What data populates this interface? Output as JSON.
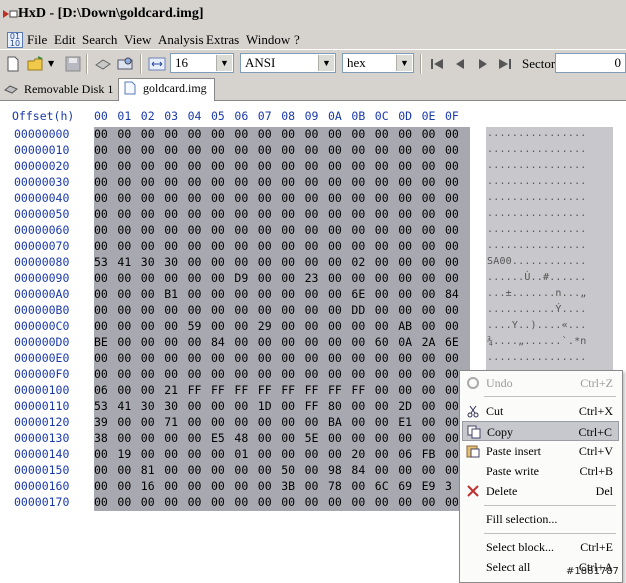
{
  "window": {
    "title": "HxD - [D:\\Down\\goldcard.img]"
  },
  "menu": [
    "File",
    "Edit",
    "Search",
    "View",
    "Analysis",
    "Extras",
    "Window",
    "?"
  ],
  "toolbar": {
    "bytes_per_row": "16",
    "charset": "ANSI",
    "offset_base": "hex",
    "sector_label": "Sector",
    "sector_value": "0"
  },
  "tabs": [
    {
      "label": "Removable Disk 1",
      "active": false
    },
    {
      "label": "goldcard.img",
      "active": true
    }
  ],
  "editor": {
    "offset_header": "Offset(h)",
    "column_headers": [
      "00",
      "01",
      "02",
      "03",
      "04",
      "05",
      "06",
      "07",
      "08",
      "09",
      "0A",
      "0B",
      "0C",
      "0D",
      "0E",
      "0F"
    ],
    "rows": [
      {
        "offset": "00000000",
        "bytes": [
          "00",
          "00",
          "00",
          "00",
          "00",
          "00",
          "00",
          "00",
          "00",
          "00",
          "00",
          "00",
          "00",
          "00",
          "00",
          "00"
        ],
        "text": "................"
      },
      {
        "offset": "00000010",
        "bytes": [
          "00",
          "00",
          "00",
          "00",
          "00",
          "00",
          "00",
          "00",
          "00",
          "00",
          "00",
          "00",
          "00",
          "00",
          "00",
          "00"
        ],
        "text": "................"
      },
      {
        "offset": "00000020",
        "bytes": [
          "00",
          "00",
          "00",
          "00",
          "00",
          "00",
          "00",
          "00",
          "00",
          "00",
          "00",
          "00",
          "00",
          "00",
          "00",
          "00"
        ],
        "text": "................"
      },
      {
        "offset": "00000030",
        "bytes": [
          "00",
          "00",
          "00",
          "00",
          "00",
          "00",
          "00",
          "00",
          "00",
          "00",
          "00",
          "00",
          "00",
          "00",
          "00",
          "00"
        ],
        "text": "................"
      },
      {
        "offset": "00000040",
        "bytes": [
          "00",
          "00",
          "00",
          "00",
          "00",
          "00",
          "00",
          "00",
          "00",
          "00",
          "00",
          "00",
          "00",
          "00",
          "00",
          "00"
        ],
        "text": "................"
      },
      {
        "offset": "00000050",
        "bytes": [
          "00",
          "00",
          "00",
          "00",
          "00",
          "00",
          "00",
          "00",
          "00",
          "00",
          "00",
          "00",
          "00",
          "00",
          "00",
          "00"
        ],
        "text": "................"
      },
      {
        "offset": "00000060",
        "bytes": [
          "00",
          "00",
          "00",
          "00",
          "00",
          "00",
          "00",
          "00",
          "00",
          "00",
          "00",
          "00",
          "00",
          "00",
          "00",
          "00"
        ],
        "text": "................"
      },
      {
        "offset": "00000070",
        "bytes": [
          "00",
          "00",
          "00",
          "00",
          "00",
          "00",
          "00",
          "00",
          "00",
          "00",
          "00",
          "00",
          "00",
          "00",
          "00",
          "00"
        ],
        "text": "................"
      },
      {
        "offset": "00000080",
        "bytes": [
          "53",
          "41",
          "30",
          "30",
          "00",
          "00",
          "00",
          "00",
          "00",
          "00",
          "00",
          "02",
          "00",
          "00",
          "00",
          "00"
        ],
        "text": "SA00............"
      },
      {
        "offset": "00000090",
        "bytes": [
          "00",
          "00",
          "00",
          "00",
          "00",
          "00",
          "D9",
          "00",
          "00",
          "23",
          "00",
          "00",
          "00",
          "00",
          "00",
          "00"
        ],
        "text": "......Ù..#......"
      },
      {
        "offset": "000000A0",
        "bytes": [
          "00",
          "00",
          "00",
          "B1",
          "00",
          "00",
          "00",
          "00",
          "00",
          "00",
          "00",
          "6E",
          "00",
          "00",
          "00",
          "84"
        ],
        "text": "...±.......n...„"
      },
      {
        "offset": "000000B0",
        "bytes": [
          "00",
          "00",
          "00",
          "00",
          "00",
          "00",
          "00",
          "00",
          "00",
          "00",
          "00",
          "DD",
          "00",
          "00",
          "00",
          "00"
        ],
        "text": "...........Ý...."
      },
      {
        "offset": "000000C0",
        "bytes": [
          "00",
          "00",
          "00",
          "00",
          "59",
          "00",
          "00",
          "29",
          "00",
          "00",
          "00",
          "00",
          "00",
          "AB",
          "00",
          "00"
        ],
        "text": "....Y..)....«..."
      },
      {
        "offset": "000000D0",
        "bytes": [
          "BE",
          "00",
          "00",
          "00",
          "00",
          "84",
          "00",
          "00",
          "00",
          "00",
          "00",
          "00",
          "60",
          "0A",
          "2A",
          "6E"
        ],
        "text": "¾....„......`.*n"
      },
      {
        "offset": "000000E0",
        "bytes": [
          "00",
          "00",
          "00",
          "00",
          "00",
          "00",
          "00",
          "00",
          "00",
          "00",
          "00",
          "00",
          "00",
          "00",
          "00",
          "00"
        ],
        "text": "................"
      },
      {
        "offset": "000000F0",
        "bytes": [
          "00",
          "00",
          "00",
          "00",
          "00",
          "00",
          "00",
          "00",
          "00",
          "00",
          "00",
          "00",
          "00",
          "00",
          "00",
          "00"
        ],
        "text": ""
      },
      {
        "offset": "00000100",
        "bytes": [
          "06",
          "00",
          "00",
          "21",
          "FF",
          "FF",
          "FF",
          "FF",
          "FF",
          "FF",
          "FF",
          "FF",
          "00",
          "00",
          "00",
          "00"
        ],
        "text": ""
      },
      {
        "offset": "00000110",
        "bytes": [
          "53",
          "41",
          "30",
          "30",
          "00",
          "00",
          "00",
          "1D",
          "00",
          "FF",
          "80",
          "00",
          "00",
          "2D",
          "00",
          "00"
        ],
        "text": ""
      },
      {
        "offset": "00000120",
        "bytes": [
          "39",
          "00",
          "00",
          "71",
          "00",
          "00",
          "00",
          "00",
          "00",
          "00",
          "BA",
          "00",
          "00",
          "E1",
          "00",
          "00"
        ],
        "text": ""
      },
      {
        "offset": "00000130",
        "bytes": [
          "38",
          "00",
          "00",
          "00",
          "00",
          "E5",
          "48",
          "00",
          "00",
          "5E",
          "00",
          "00",
          "00",
          "00",
          "00",
          "00"
        ],
        "text": ""
      },
      {
        "offset": "00000140",
        "bytes": [
          "00",
          "19",
          "00",
          "00",
          "00",
          "00",
          "01",
          "00",
          "00",
          "00",
          "00",
          "20",
          "00",
          "06",
          "FB",
          "00"
        ],
        "text": ""
      },
      {
        "offset": "00000150",
        "bytes": [
          "00",
          "00",
          "81",
          "00",
          "00",
          "00",
          "00",
          "00",
          "50",
          "00",
          "98",
          "84",
          "00",
          "00",
          "00",
          "00"
        ],
        "text": ""
      },
      {
        "offset": "00000160",
        "bytes": [
          "00",
          "00",
          "16",
          "00",
          "00",
          "00",
          "00",
          "00",
          "3B",
          "00",
          "78",
          "00",
          "6C",
          "69",
          "E9",
          "3"
        ],
        "text": ""
      },
      {
        "offset": "00000170",
        "bytes": [
          "00",
          "00",
          "00",
          "00",
          "00",
          "00",
          "00",
          "00",
          "00",
          "00",
          "00",
          "00",
          "00",
          "00",
          "00",
          "00"
        ],
        "text": ""
      }
    ]
  },
  "context_menu": {
    "items": [
      {
        "label": "Undo",
        "shortcut": "Ctrl+Z",
        "icon": "undo-icon",
        "disabled": true
      },
      {
        "label": "Cut",
        "shortcut": "Ctrl+X",
        "icon": "scissors-icon"
      },
      {
        "label": "Copy",
        "shortcut": "Ctrl+C",
        "icon": "copy-icon",
        "highlighted": true
      },
      {
        "label": "Paste insert",
        "shortcut": "Ctrl+V",
        "icon": "paste-icon"
      },
      {
        "label": "Paste write",
        "shortcut": "Ctrl+B"
      },
      {
        "label": "Delete",
        "shortcut": "Del",
        "icon": "delete-x-icon"
      },
      {
        "label": "Fill selection..."
      },
      {
        "label": "Select block...",
        "shortcut": "Ctrl+E"
      },
      {
        "label": "Select all",
        "shortcut": "Ctrl+A"
      }
    ]
  },
  "watermark": "#1881787"
}
